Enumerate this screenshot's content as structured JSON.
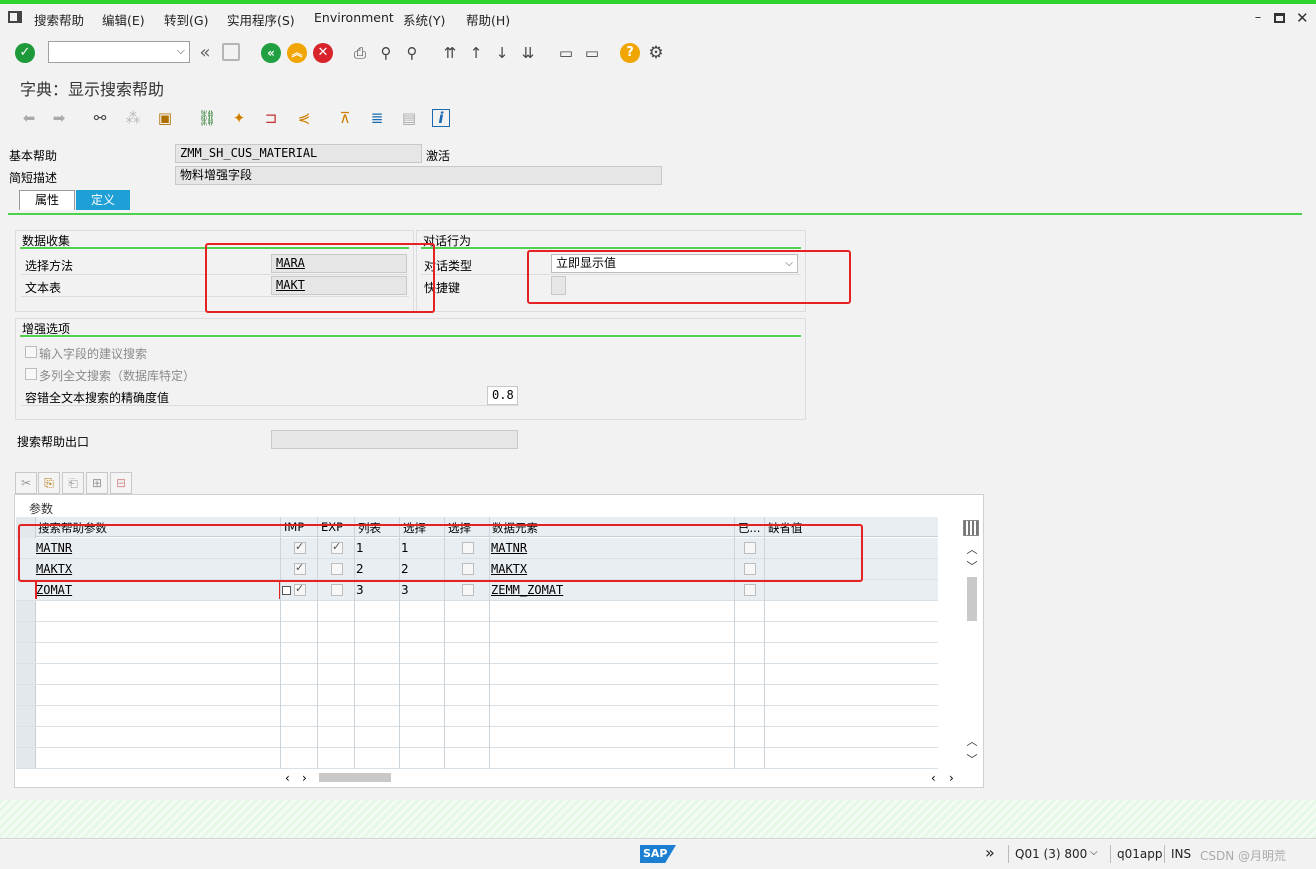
{
  "menu": {
    "items": [
      "搜索帮助",
      "编辑(E)",
      "转到(G)",
      "实用程序(S)",
      "Environment",
      "系统(Y)",
      "帮助(H)"
    ]
  },
  "toolbar": {
    "command_value": ""
  },
  "page": {
    "title": "字典：显示搜索帮助"
  },
  "header": {
    "search_help_label": "基本帮助",
    "search_help_value": "ZMM_SH_CUS_MATERIAL",
    "status": "激活",
    "short_desc_label": "简短描述",
    "short_desc_value": "物料增强字段"
  },
  "tabs": [
    {
      "label": "属性",
      "active": false
    },
    {
      "label": "定义",
      "active": true
    }
  ],
  "data_collection": {
    "title": "数据收集",
    "selection_method_label": "选择方法",
    "selection_method_value": "MARA",
    "text_table_label": "文本表",
    "text_table_value": "MAKT"
  },
  "dialog_behavior": {
    "title": "对话行为",
    "dialog_type_label": "对话类型",
    "dialog_type_value": "立即显示值",
    "hotkey_label": "快捷键",
    "hotkey_value": ""
  },
  "enhanced_options": {
    "title": "增强选项",
    "proposal_search_label": "输入字段的建议搜索",
    "multi_col_search_label": "多列全文搜索（数据库特定）",
    "accuracy_label": "容错全文本搜索的精确度值",
    "accuracy_value": "0.8"
  },
  "exit": {
    "label": "搜索帮助出口",
    "value": ""
  },
  "params_table": {
    "caption": "参数",
    "columns": [
      "搜索帮助参数",
      "IMP",
      "EXP",
      "列表",
      "选择",
      "选择",
      "数据元素",
      "已...",
      "缺省值"
    ],
    "rows": [
      {
        "param": "MATNR",
        "imp": true,
        "exp": true,
        "lpos": "1",
        "spos": "1",
        "sdis": false,
        "element": "MATNR",
        "mod": false,
        "default": ""
      },
      {
        "param": "MAKTX",
        "imp": true,
        "exp": false,
        "lpos": "2",
        "spos": "2",
        "sdis": false,
        "element": "MAKTX",
        "mod": false,
        "default": ""
      },
      {
        "param": "ZOMAT",
        "imp": true,
        "exp": false,
        "lpos": "3",
        "spos": "3",
        "sdis": false,
        "element": "ZEMM_ZOMAT",
        "mod": false,
        "default": ""
      }
    ]
  },
  "status_bar": {
    "system": "Q01 (3) 800",
    "server": "q01app",
    "mode": "INS",
    "watermark": "CSDN @月明荒"
  },
  "colors": {
    "accent_green": "#2fd52f",
    "active_tab": "#1e9fd6",
    "annotation_red": "#e52222"
  },
  "icons": [
    "menu-icon",
    "check-icon",
    "back-icon",
    "save-icon",
    "exit-icon",
    "cancel-icon",
    "print-icon",
    "find-icon",
    "find-next-icon",
    "first-page-icon",
    "prev-page-icon",
    "next-page-icon",
    "last-page-icon",
    "new-session-icon",
    "shortcut-icon",
    "help-icon",
    "settings-icon"
  ]
}
